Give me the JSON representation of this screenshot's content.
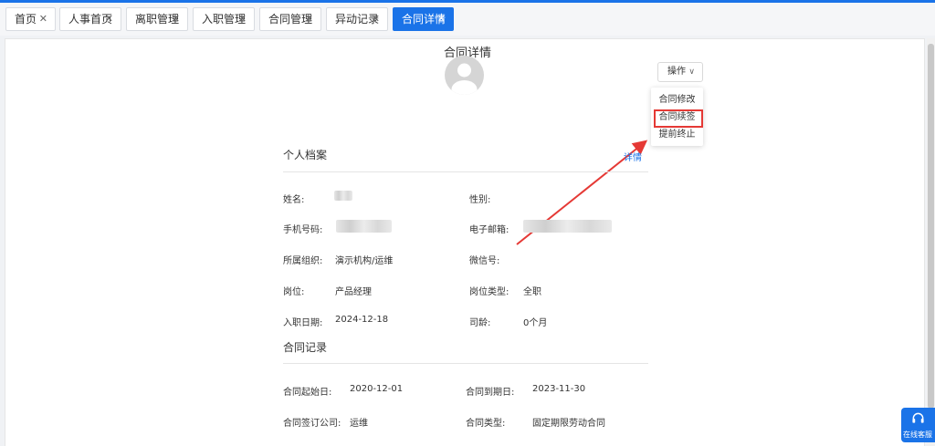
{
  "tabs": [
    {
      "label": "首页"
    },
    {
      "label": "人事首页"
    },
    {
      "label": "离职管理"
    },
    {
      "label": "入职管理"
    },
    {
      "label": "合同管理"
    },
    {
      "label": "异动记录"
    },
    {
      "label": "合同详情",
      "active": true
    }
  ],
  "page": {
    "title": "合同详情"
  },
  "operations": {
    "button_label": "操作",
    "menu": [
      "合同修改",
      "合同续签",
      "提前终止"
    ],
    "highlighted": "合同续签"
  },
  "profile": {
    "section_title": "个人档案",
    "detail_link": "详情",
    "fields": {
      "name": {
        "label": "姓名:",
        "value": ""
      },
      "gender": {
        "label": "性别:",
        "value": ""
      },
      "phone": {
        "label": "手机号码:",
        "value": ""
      },
      "email": {
        "label": "电子邮箱:",
        "value": ""
      },
      "org": {
        "label": "所属组织:",
        "value": "演示机构/运维"
      },
      "wechat": {
        "label": "微信号:",
        "value": ""
      },
      "position": {
        "label": "岗位:",
        "value": "产品经理"
      },
      "position_type": {
        "label": "岗位类型:",
        "value": "全职"
      },
      "hire_date": {
        "label": "入职日期:",
        "value": "2024-12-18"
      },
      "tenure": {
        "label": "司龄:",
        "value": "0个月"
      }
    }
  },
  "contract": {
    "section_title": "合同记录",
    "fields": {
      "start": {
        "label": "合同起始日:",
        "value": "2020-12-01"
      },
      "end": {
        "label": "合同到期日:",
        "value": "2023-11-30"
      },
      "company": {
        "label": "合同签订公司:",
        "value": "运维"
      },
      "type": {
        "label": "合同类型:",
        "value": "固定期限劳动合同"
      }
    }
  },
  "service": {
    "label": "在线客服"
  },
  "colors": {
    "accent": "#1a73e8",
    "highlight": "#e53935"
  }
}
